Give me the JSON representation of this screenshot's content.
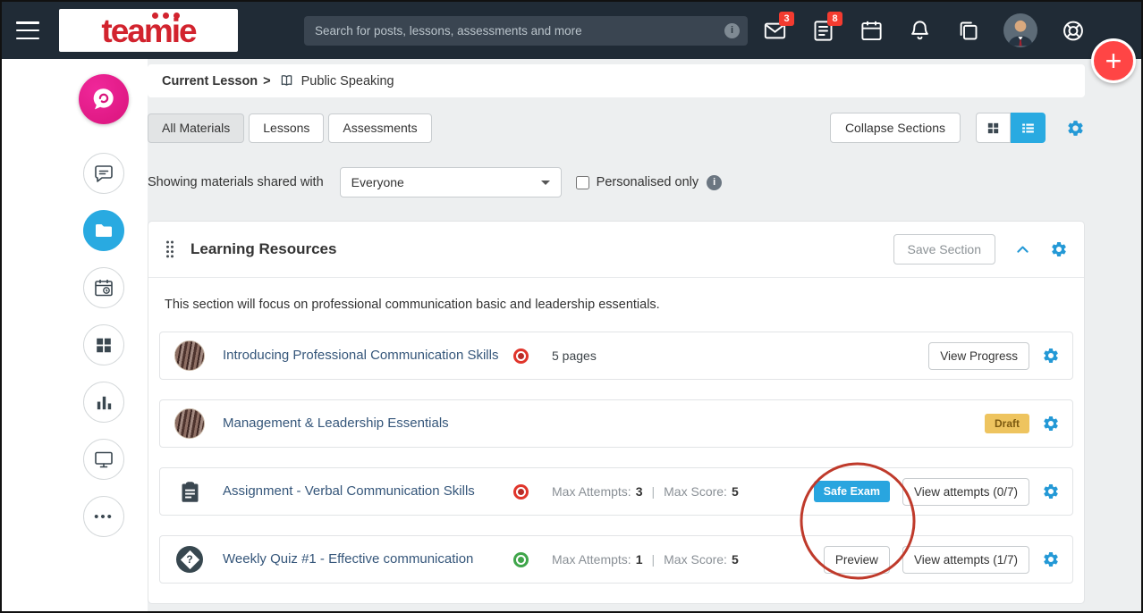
{
  "colors": {
    "topbar_bg": "#202b36",
    "brand_red": "#d2232e",
    "accent_blue": "#29aae1",
    "gear_blue": "#2499d6",
    "fab_red": "#ff4545",
    "badge_red": "#f43b30",
    "title_link": "#35567a",
    "draft_bg": "#eec45f",
    "safe_exam_bg": "#29a5df",
    "status_red": "#e0352b",
    "status_green": "#3fa54a",
    "annotation_red": "#bf3a2b"
  },
  "glyphs": {
    "plus": "+",
    "info": "i",
    "ellipsis": "•••"
  },
  "topbar": {
    "logo_text": "teamie",
    "search_placeholder": "Search for posts, lessons, assessments and more",
    "mail_badge": "3",
    "tasks_badge": "8"
  },
  "breadcrumb": {
    "lesson_label": "Current Lesson",
    "separator": ">",
    "page_title": "Public Speaking"
  },
  "tabs": [
    {
      "label": "All Materials",
      "active": true
    },
    {
      "label": "Lessons",
      "active": false
    },
    {
      "label": "Assessments",
      "active": false
    }
  ],
  "toolbar": {
    "collapse_sections_label": "Collapse Sections"
  },
  "filter": {
    "shared_with_label": "Showing materials shared with",
    "shared_with_value": "Everyone",
    "personalised_label": "Personalised only"
  },
  "section": {
    "title": "Learning Resources",
    "save_button_label": "Save Section",
    "description": "This section will focus on professional communication basic and leadership essentials.",
    "materials": [
      {
        "title": "Introducing Professional Communication Skills",
        "status": "red",
        "meta": "5 pages",
        "action_label": "View Progress"
      },
      {
        "title": "Management & Leadership Essentials",
        "badge": "Draft"
      },
      {
        "title": "Assignment - Verbal Communication Skills",
        "status": "red",
        "attempts_label": "Max Attempts:",
        "attempts_value": "3",
        "separator": "|",
        "score_label": "Max Score:",
        "score_value": "5",
        "safe_exam_label": "Safe Exam",
        "action_label": "View attempts (0/7)"
      },
      {
        "title": "Weekly Quiz #1 - Effective communication",
        "status": "green",
        "attempts_label": "Max Attempts:",
        "attempts_value": "1",
        "separator": "|",
        "score_label": "Max Score:",
        "score_value": "5",
        "preview_label": "Preview",
        "action_label": "View attempts (1/7)"
      }
    ]
  }
}
